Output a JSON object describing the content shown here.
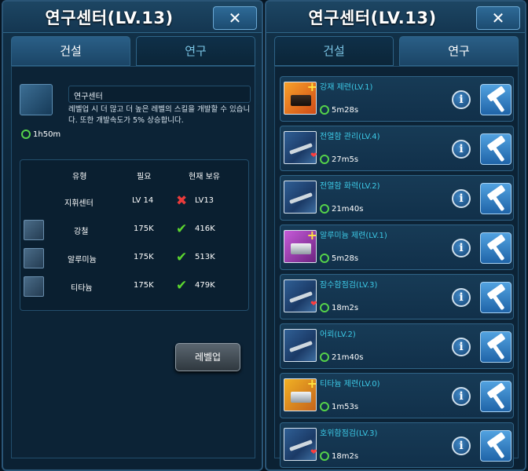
{
  "left_panel": {
    "title": "연구센터(LV.13)",
    "close_label": "✕",
    "tabs": [
      {
        "label": "건설",
        "active": true
      },
      {
        "label": "연구",
        "active": false
      }
    ],
    "research": {
      "name": "연구센터",
      "description": "레벨업 시 더 많고 더 높은 레벨의 스킬을 개발할 수 있습니다. 또한 개발속도가 5% 상승합니다.",
      "time": "1h50m"
    },
    "requirements": {
      "headers": {
        "type": "유형",
        "required": "필요",
        "owned": "현재 보유"
      },
      "rows": [
        {
          "type": "지휘센터",
          "required": "LV 14",
          "owned": "LV13",
          "met": false
        },
        {
          "type": "강철",
          "required": "175K",
          "owned": "416K",
          "met": true,
          "icon": "steel-icon"
        },
        {
          "type": "알루미늄",
          "required": "175K",
          "owned": "513K",
          "met": true,
          "icon": "aluminum-icon"
        },
        {
          "type": "티타늄",
          "required": "175K",
          "owned": "479K",
          "met": true,
          "icon": "titanium-icon"
        }
      ]
    },
    "level_up_label": "레벨업"
  },
  "right_panel": {
    "title": "연구센터(LV.13)",
    "close_label": "✕",
    "tabs": [
      {
        "label": "건설",
        "active": false
      },
      {
        "label": "연구",
        "active": true
      }
    ],
    "items": [
      {
        "name": "강재 제련(LV.1)",
        "time": "5m28s",
        "thumb": "steel"
      },
      {
        "name": "전열함 관리(LV.4)",
        "time": "27m5s",
        "thumb": "ship"
      },
      {
        "name": "전열함 화력(LV.2)",
        "time": "21m40s",
        "thumb": "ship"
      },
      {
        "name": "알루미늄 제련(LV.1)",
        "time": "5m28s",
        "thumb": "alu"
      },
      {
        "name": "잠수함점검(LV.3)",
        "time": "18m2s",
        "thumb": "ship"
      },
      {
        "name": "어뢰(LV.2)",
        "time": "21m40s",
        "thumb": "ship"
      },
      {
        "name": "티타늄 제련(LV.0)",
        "time": "1m53s",
        "thumb": "ti"
      },
      {
        "name": "호위함점검(LV.3)",
        "time": "18m2s",
        "thumb": "ship"
      }
    ],
    "info_label": "i"
  },
  "colors": {
    "accent_text": "#3cc9e6",
    "timer_green": "#55d24a",
    "check_green": "#5cd62f",
    "cross_red": "#ea3b3b"
  }
}
